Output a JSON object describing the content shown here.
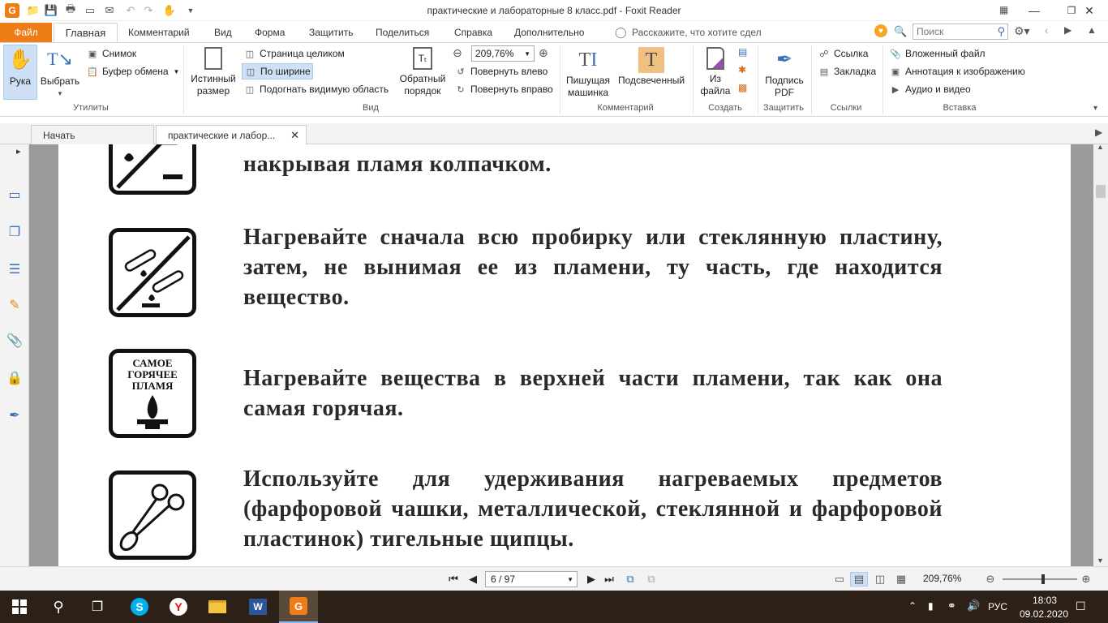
{
  "window": {
    "title": "практические и лабораторные 8 класс.pdf - Foxit Reader"
  },
  "menu": {
    "file": "Файл",
    "tabs": [
      "Главная",
      "Комментарий",
      "Вид",
      "Форма",
      "Защитить",
      "Поделиться",
      "Справка",
      "Дополнительно"
    ],
    "tell_me": "Расскажите, что хотите сдел",
    "search_placeholder": "Поиск"
  },
  "ribbon": {
    "hand": "Рука",
    "select": "Выбрать",
    "snapshot": "Снимок",
    "clipboard": "Буфер обмена",
    "utilities_label": "Утилиты",
    "actual_size_1": "Истинный",
    "actual_size_2": "размер",
    "fit_page": "Страница целиком",
    "fit_width": "По ширине",
    "fit_visible": "Подогнать видимую область",
    "reverse_1": "Обратный",
    "reverse_2": "порядок",
    "zoom_value": "209,76%",
    "rotate_left": "Повернуть влево",
    "rotate_right": "Повернуть вправо",
    "view_label": "Вид",
    "typewriter_1": "Пишущая",
    "typewriter_2": "машинка",
    "highlight": "Подсвеченный",
    "comment_label": "Комментарий",
    "from_file_1": "Из",
    "from_file_2": "файла",
    "create_label": "Создать",
    "sign_1": "Подпись",
    "sign_2": "PDF",
    "protect_label": "Защитить",
    "link": "Ссылка",
    "bookmark": "Закладка",
    "links_label": "Ссылки",
    "attachment": "Вложенный файл",
    "image_annot": "Аннотация к изображению",
    "audio_video": "Аудио и видео",
    "insert_label": "Вставка"
  },
  "tabs": {
    "start": "Начать",
    "document": "практические и лабор..."
  },
  "document": {
    "p1": "накрывая пламя колпачком.",
    "p2": "Нагревайте сначала всю пробирку или стеклянную пластину, затем, не вынимая ее из пламени, ту часть, где находится вещество.",
    "p3": "Нагревайте вещества в верхней части пламени, так как она самая горячая.",
    "p4": "Используйте для удерживания нагреваемых предметов (фарфоровой чашки, металлической, стеклянной и фарфоровой пластинок) тигельные щипцы.",
    "picto3_text": [
      "САМОЕ",
      "ГОРЯЧЕЕ",
      "ПЛАМЯ"
    ]
  },
  "status": {
    "page": "6 / 97",
    "zoom": "209,76%",
    "zoom_fraction": 0.55
  },
  "taskbar": {
    "lang": "РУС",
    "time": "18:03",
    "date": "09.02.2020"
  },
  "colors": {
    "accent": "#ef7d17",
    "hover": "#cde0f5",
    "taskbar": "#2d2016"
  }
}
